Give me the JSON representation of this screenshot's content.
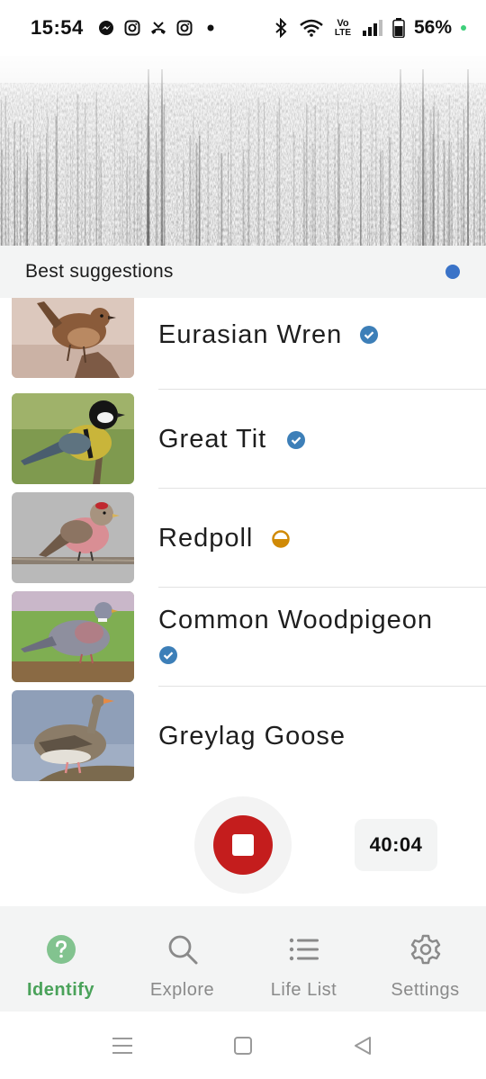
{
  "status_bar": {
    "time": "15:54",
    "notification_icons": [
      "messenger-icon",
      "instagram-icon",
      "missed-call-icon",
      "instagram-icon",
      "dot-icon"
    ],
    "system_icons": [
      "bluetooth-icon",
      "wifi-icon",
      "volte-icon",
      "signal-icon",
      "battery-icon"
    ],
    "volte_label_top": "Vo",
    "volte_label_bottom": "LTE",
    "battery_percent": "56%"
  },
  "suggestions": {
    "title": "Best suggestions",
    "indicator_color": "#3a73c8"
  },
  "species": [
    {
      "name": "Eurasian Wren",
      "status": "verified",
      "status_icon": "verified-check-icon",
      "status_color": "#3d7fb8"
    },
    {
      "name": "Great Tit",
      "status": "verified",
      "status_icon": "verified-check-icon",
      "status_color": "#3d7fb8"
    },
    {
      "name": "Redpoll",
      "status": "partial",
      "status_icon": "half-circle-icon",
      "status_color": "#d08a06"
    },
    {
      "name": "Common Woodpigeon",
      "status": "verified",
      "status_icon": "verified-check-icon",
      "status_color": "#3d7fb8"
    },
    {
      "name": "Greylag Goose",
      "status": "none",
      "status_icon": "",
      "status_color": ""
    }
  ],
  "recorder": {
    "timer": "40:04",
    "button_color": "#c41d1d"
  },
  "bottom_nav": [
    {
      "label": "Identify",
      "icon": "question-icon",
      "active": true
    },
    {
      "label": "Explore",
      "icon": "search-icon",
      "active": false
    },
    {
      "label": "Life List",
      "icon": "list-icon",
      "active": false
    },
    {
      "label": "Settings",
      "icon": "gear-icon",
      "active": false
    }
  ],
  "colors": {
    "accent_green": "#4aa25a",
    "record_red": "#c41d1d",
    "verified_blue": "#3d7fb8",
    "partial_orange": "#d08a06"
  }
}
